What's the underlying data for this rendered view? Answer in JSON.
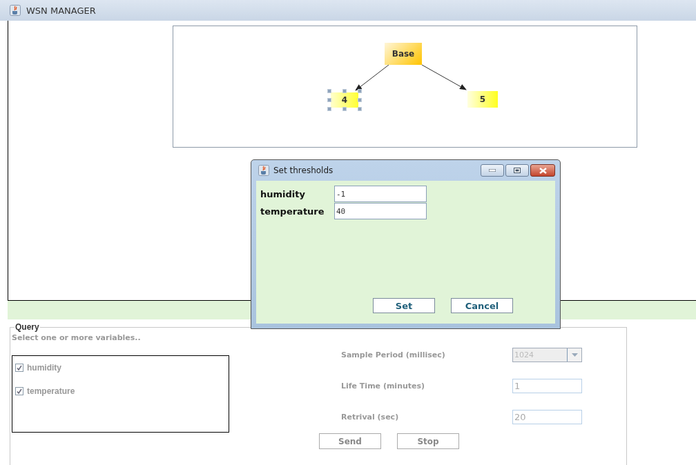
{
  "window": {
    "title": "WSN MANAGER"
  },
  "graph": {
    "nodes": [
      {
        "label": "Base",
        "kind": "base",
        "selected": false
      },
      {
        "label": "4",
        "kind": "sensor",
        "selected": true
      },
      {
        "label": "5",
        "kind": "sensor",
        "selected": false
      }
    ]
  },
  "dialog": {
    "title": "Set thresholds",
    "fields": [
      {
        "label": "humidity",
        "value": "-1"
      },
      {
        "label": "temperature",
        "value": "40"
      }
    ],
    "buttons": [
      "Set",
      "Cancel"
    ]
  },
  "query": {
    "title": "Query",
    "disabled": true,
    "hint": "Select one or more variables..",
    "variables": [
      {
        "label": "humidity",
        "checked": true
      },
      {
        "label": "temperature",
        "checked": true
      }
    ],
    "settings": [
      {
        "label": "Sample Period (millisec)",
        "kind": "dropdown",
        "value": "1024"
      },
      {
        "label": "Life Time (minutes)",
        "kind": "text",
        "value": "1"
      },
      {
        "label": "Retrival (sec)",
        "kind": "text",
        "value": "20"
      }
    ],
    "buttons": [
      "Send",
      "Stop"
    ]
  }
}
